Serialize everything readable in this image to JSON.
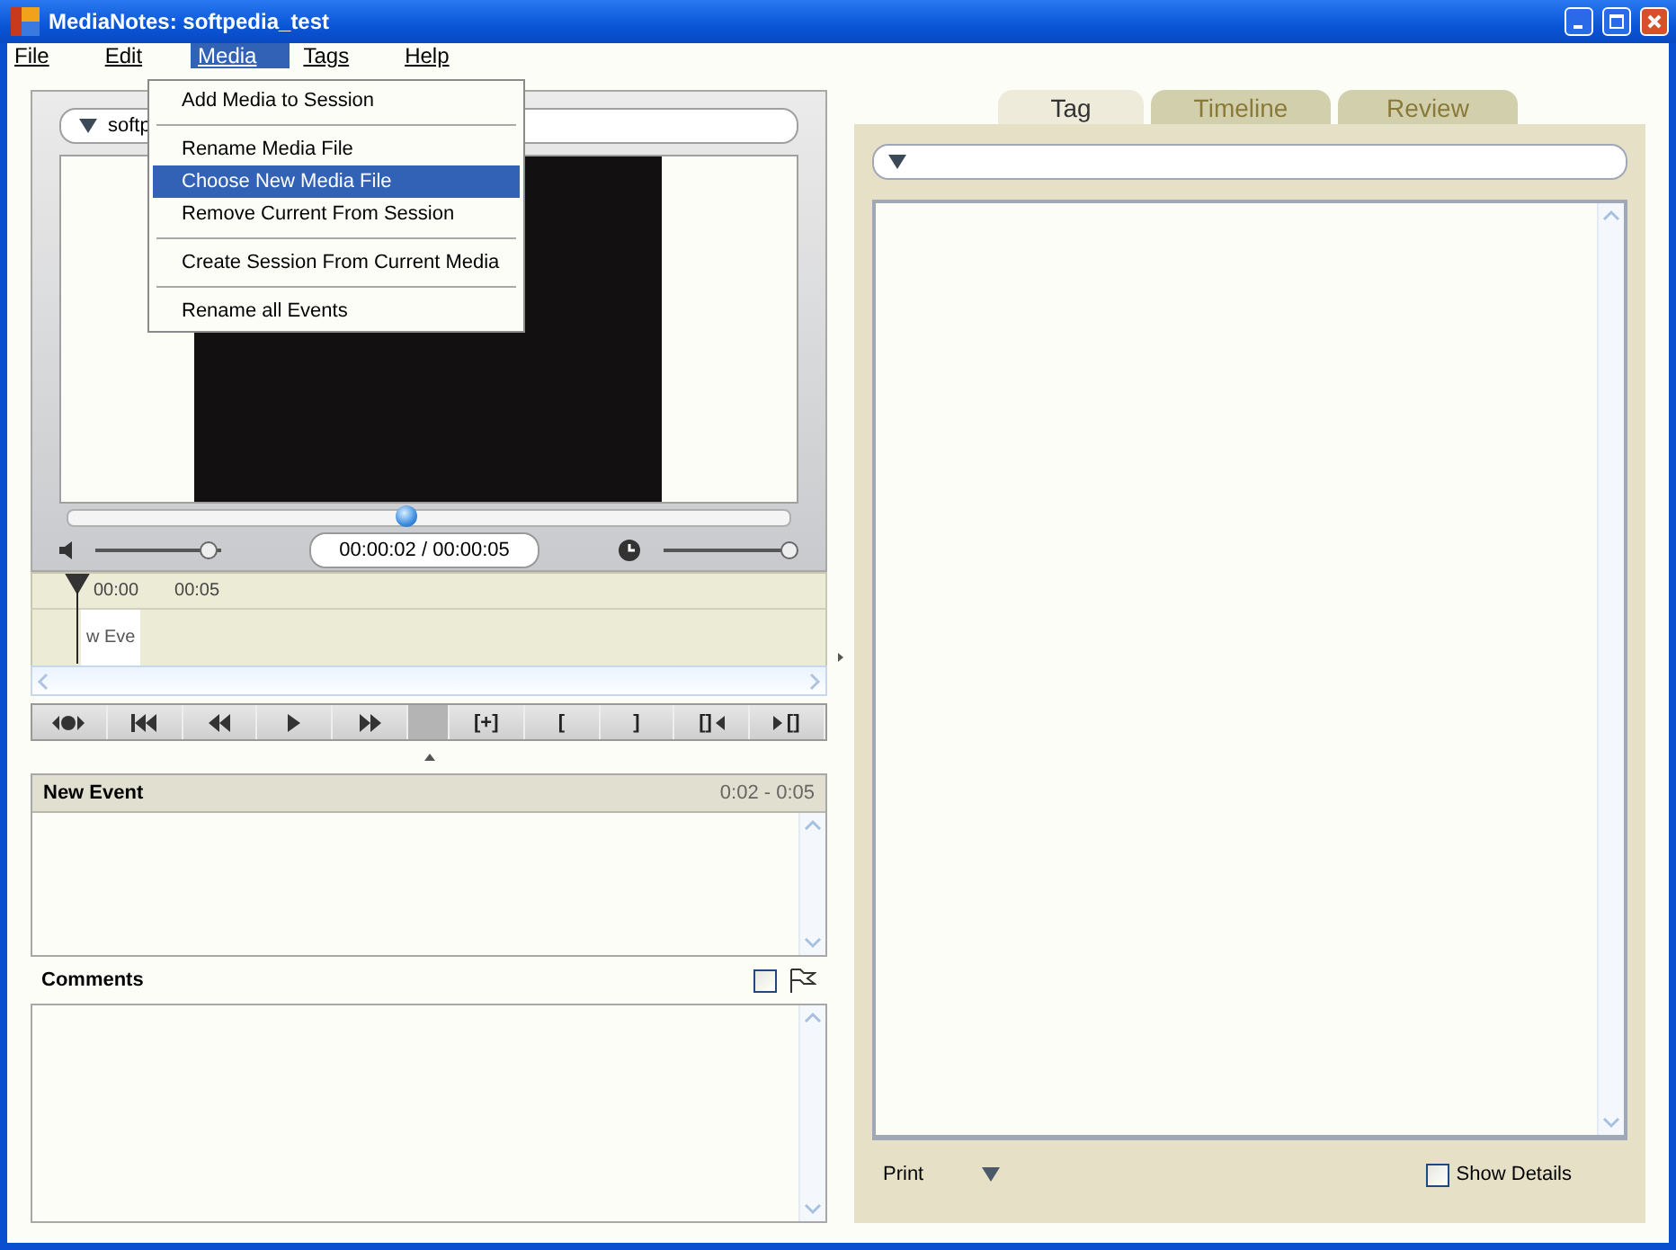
{
  "window": {
    "title": "MediaNotes: softpedia_test"
  },
  "menu_bar": [
    {
      "label": "File",
      "selected": false
    },
    {
      "label": "Edit",
      "selected": false
    },
    {
      "label": "Media",
      "selected": true
    },
    {
      "label": "Tags",
      "selected": false
    },
    {
      "label": "Help",
      "selected": false
    }
  ],
  "open_menu": {
    "items": [
      {
        "label": "Add Media to Session",
        "selected": false,
        "separator_after": true
      },
      {
        "label": "Rename Media File",
        "selected": false,
        "separator_after": false
      },
      {
        "label": "Choose New Media File",
        "selected": true,
        "separator_after": false
      },
      {
        "label": "Remove Current From Session",
        "selected": false,
        "separator_after": true
      },
      {
        "label": "Create Session From Current Media",
        "selected": false,
        "separator_after": true
      },
      {
        "label": "Rename all Events",
        "selected": false,
        "separator_after": false
      }
    ]
  },
  "player": {
    "media_file": "softp",
    "seek": {
      "level": 0.47
    },
    "volume": {
      "level": 0.9
    },
    "time": "00:00:02 / 00:00:05",
    "speed": {
      "level": 1.0
    }
  },
  "timeline": {
    "ruler": [
      "00:00",
      "00:05"
    ],
    "event_label": "w Eve"
  },
  "transport": [
    {
      "kind": "loop"
    },
    {
      "kind": "first"
    },
    {
      "kind": "rewind"
    },
    {
      "kind": "play"
    },
    {
      "kind": "forward"
    },
    {
      "kind": "blank"
    },
    {
      "kind": "text",
      "label": "[+]"
    },
    {
      "kind": "text",
      "label": "["
    },
    {
      "kind": "text",
      "label": "]"
    },
    {
      "kind": "text-prev",
      "label": "[]"
    },
    {
      "kind": "next-text",
      "label": "[]"
    }
  ],
  "event": {
    "title": "New Event",
    "range": "0:02 - 0:05"
  },
  "comments": {
    "label": "Comments",
    "checked": false
  },
  "tabs": [
    {
      "label": "Tag",
      "selected": true
    },
    {
      "label": "Timeline",
      "selected": false
    },
    {
      "label": "Review",
      "selected": false
    }
  ],
  "footer": {
    "print": "Print",
    "show_details": {
      "label": "Show Details",
      "checked": false
    }
  }
}
